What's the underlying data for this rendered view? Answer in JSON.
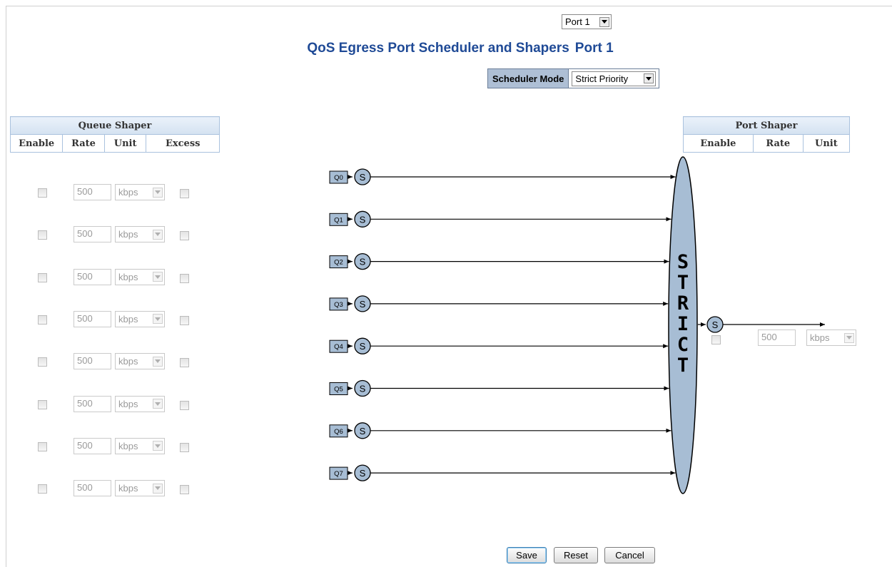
{
  "port_select": {
    "value": "Port 1"
  },
  "title": {
    "text": "QoS Egress Port Scheduler and Shapers",
    "port": "Port 1"
  },
  "scheduler_mode": {
    "label": "Scheduler Mode",
    "value": "Strict Priority"
  },
  "queue_shaper": {
    "header": "Queue Shaper",
    "columns": [
      "Enable",
      "Rate",
      "Unit",
      "Excess"
    ],
    "rows": [
      {
        "enabled": false,
        "rate": "500",
        "unit": "kbps",
        "excess": false
      },
      {
        "enabled": false,
        "rate": "500",
        "unit": "kbps",
        "excess": false
      },
      {
        "enabled": false,
        "rate": "500",
        "unit": "kbps",
        "excess": false
      },
      {
        "enabled": false,
        "rate": "500",
        "unit": "kbps",
        "excess": false
      },
      {
        "enabled": false,
        "rate": "500",
        "unit": "kbps",
        "excess": false
      },
      {
        "enabled": false,
        "rate": "500",
        "unit": "kbps",
        "excess": false
      },
      {
        "enabled": false,
        "rate": "500",
        "unit": "kbps",
        "excess": false
      },
      {
        "enabled": false,
        "rate": "500",
        "unit": "kbps",
        "excess": false
      }
    ]
  },
  "port_shaper": {
    "header": "Port Shaper",
    "columns": [
      "Enable",
      "Rate",
      "Unit"
    ],
    "enabled": false,
    "rate": "500",
    "unit": "kbps"
  },
  "diagram": {
    "queues": [
      "Q0",
      "Q1",
      "Q2",
      "Q3",
      "Q4",
      "Q5",
      "Q6",
      "Q7"
    ],
    "shaper_symbol": "S",
    "scheduler_letters": [
      "S",
      "T",
      "R",
      "I",
      "C",
      "T"
    ]
  },
  "buttons": {
    "save": "Save",
    "reset": "Reset",
    "cancel": "Cancel"
  },
  "colors": {
    "title": "#1f4a96",
    "header_bg": "#aebfd5",
    "diagram_fill": "#a7bdd4"
  }
}
